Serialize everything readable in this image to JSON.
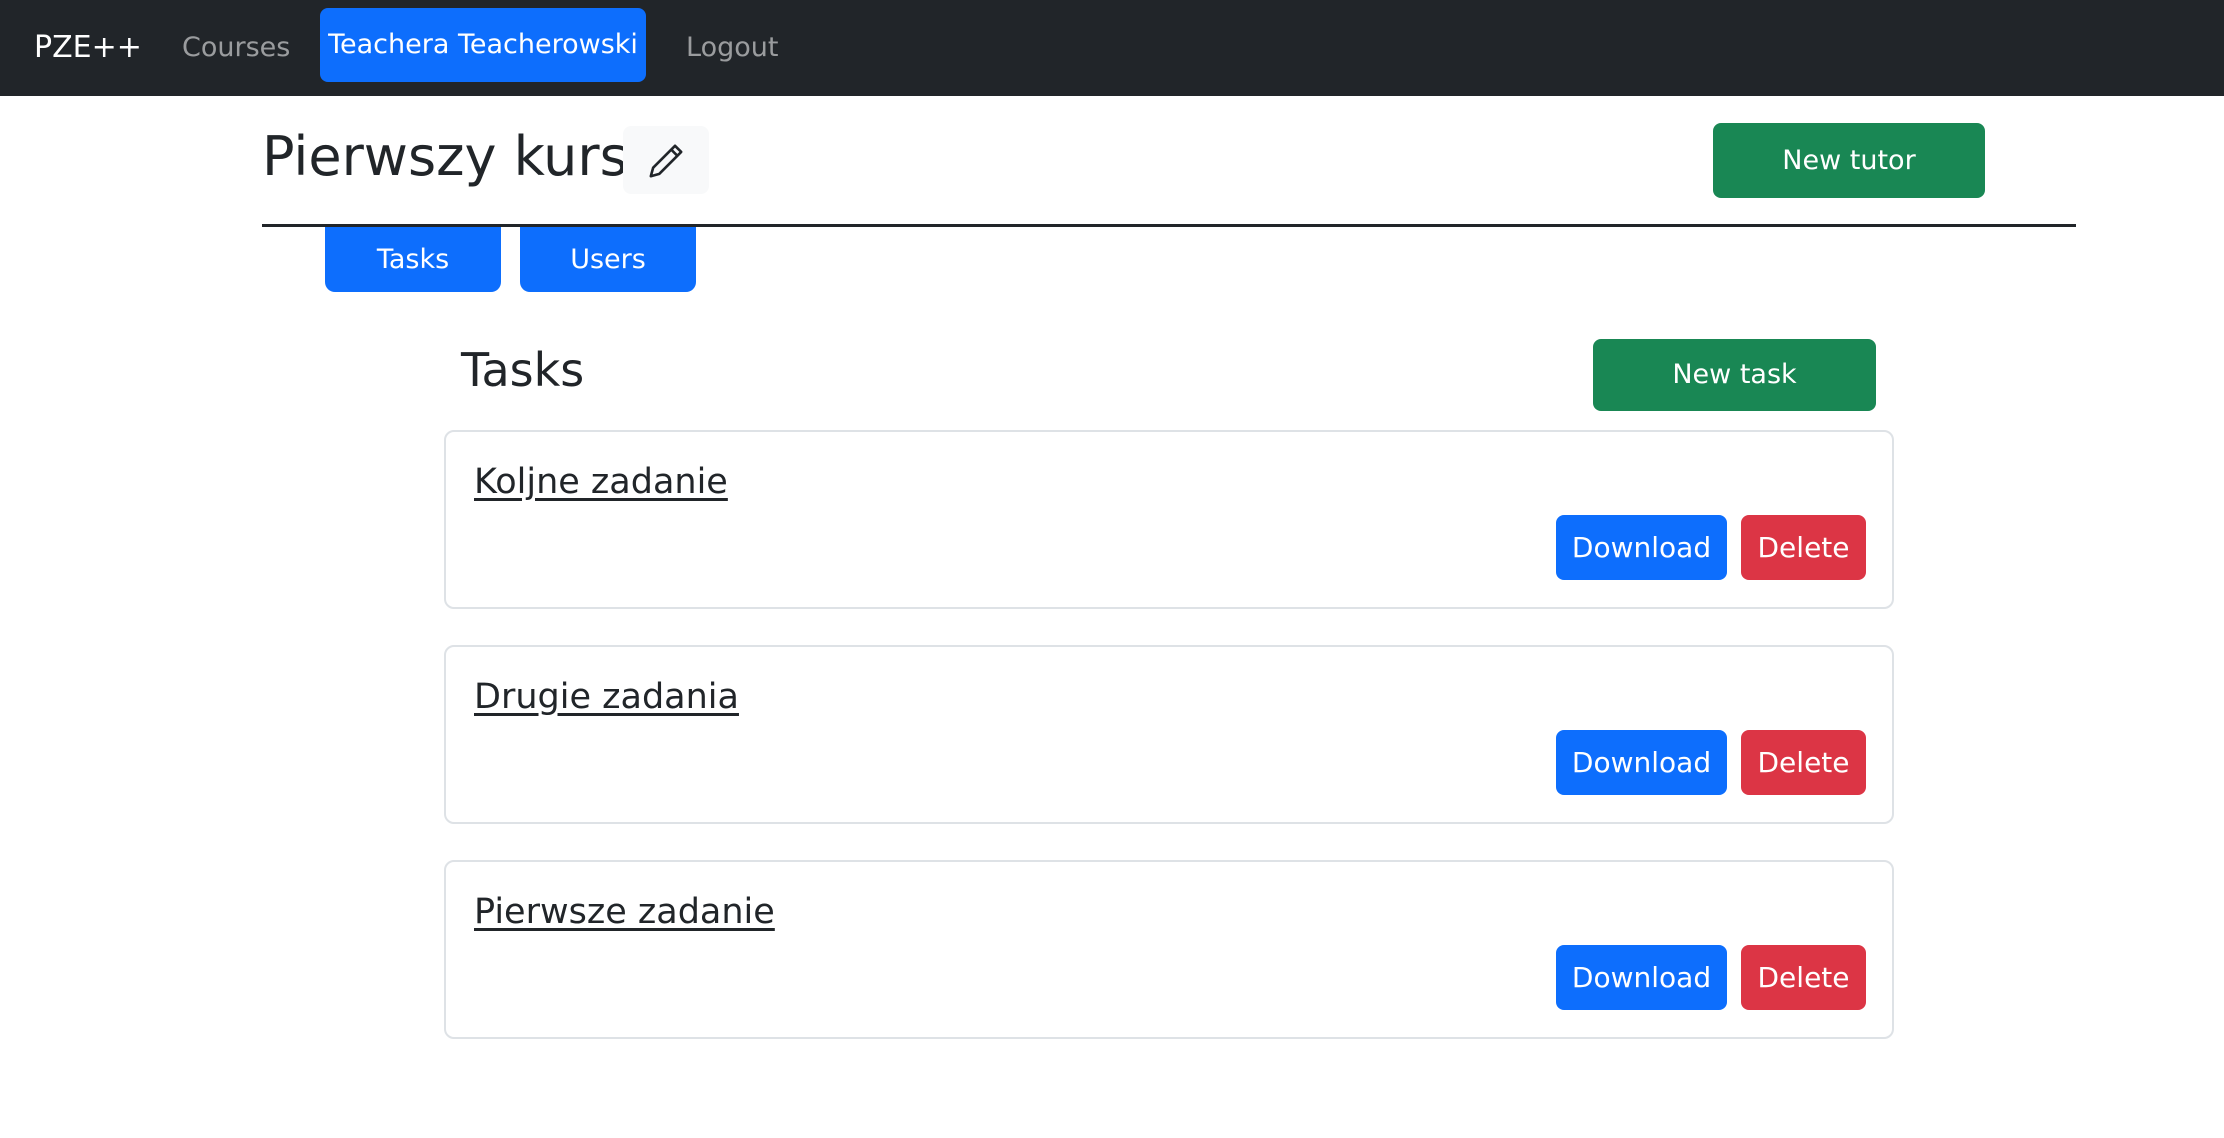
{
  "navbar": {
    "brand": "PZE++",
    "links": {
      "courses": "Courses",
      "user": "Teachera Teacherowski",
      "logout": "Logout"
    }
  },
  "course": {
    "title": "Pierwszy kurs",
    "edit_icon": "pencil-icon",
    "new_tutor_label": "New tutor"
  },
  "tabs": [
    {
      "label": "Tasks"
    },
    {
      "label": "Users"
    }
  ],
  "tasks_section": {
    "title": "Tasks",
    "new_task_label": "New task",
    "items": [
      {
        "title": "Koljne zadanie",
        "download_label": "Download",
        "delete_label": "Delete"
      },
      {
        "title": "Drugie zadania",
        "download_label": "Download",
        "delete_label": "Delete"
      },
      {
        "title": "Pierwsze zadanie",
        "download_label": "Download",
        "delete_label": "Delete"
      }
    ]
  },
  "colors": {
    "navbar_bg": "#212529",
    "primary": "#0d6efd",
    "success": "#198754",
    "danger": "#dc3545"
  }
}
